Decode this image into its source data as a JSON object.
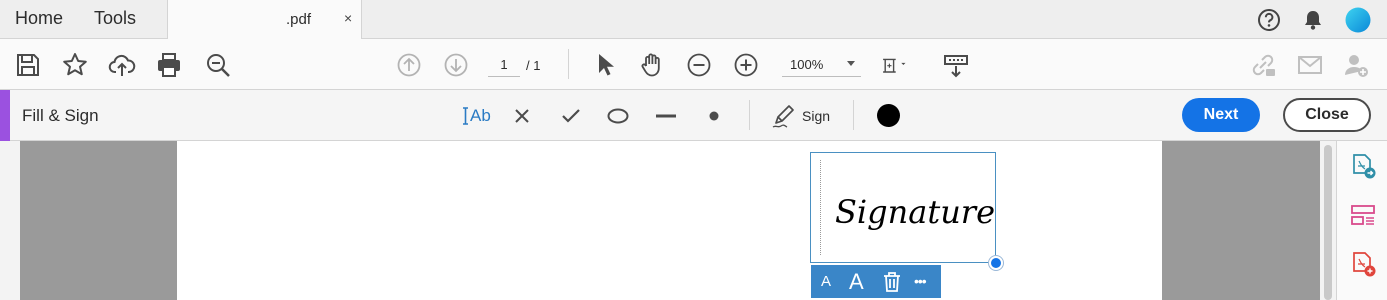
{
  "menu": {
    "home_label": "Home",
    "tools_label": "Tools"
  },
  "document_tab": {
    "title": ".pdf",
    "close_glyph": "×"
  },
  "header_icons": [
    "help-icon",
    "notifications-bell-icon",
    "account-avatar"
  ],
  "toolbar": {
    "page_current": "1",
    "page_total": "/ 1",
    "zoom": "100%"
  },
  "fill_sign": {
    "title": "Fill & Sign",
    "text_tool_label": "Ab",
    "sign_label": "Sign",
    "ink_color": "#000000",
    "next_label": "Next",
    "close_label": "Close"
  },
  "signature": {
    "text": "Signature"
  },
  "signature_toolbar": {
    "small_a": "A",
    "large_a": "A",
    "more": "•••"
  },
  "colors": {
    "accent_purple": "#9b51e0",
    "primary_blue": "#1473e6",
    "field_toolbar": "#3a86c8"
  }
}
